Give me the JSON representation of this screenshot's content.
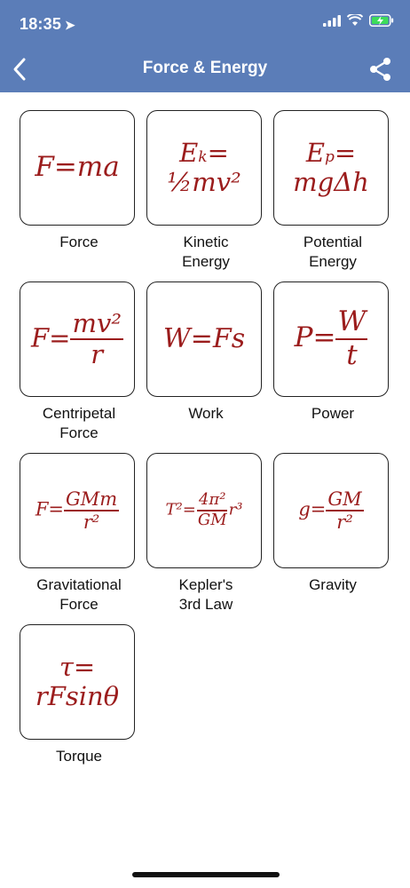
{
  "status_bar": {
    "time": "18:35",
    "battery": "charging"
  },
  "nav": {
    "title": "Force & Energy"
  },
  "formulas": [
    {
      "id": "force",
      "label_1": "Force",
      "label_2": "",
      "formula": "F=ma"
    },
    {
      "id": "kinetic",
      "label_1": "Kinetic",
      "label_2": "Energy",
      "line1_a": "E",
      "line1_sub": "k",
      "line1_b": "=",
      "line2": "½mv²"
    },
    {
      "id": "potential",
      "label_1": "Potential",
      "label_2": "Energy",
      "line1_a": "E",
      "line1_sub": "p",
      "line1_b": "=",
      "line2": "mgΔh"
    },
    {
      "id": "centripetal",
      "label_1": "Centripetal",
      "label_2": "Force",
      "lhs": "F=",
      "num": "mv²",
      "den": "r"
    },
    {
      "id": "work",
      "label_1": "Work",
      "label_2": "",
      "formula": "W=Fs"
    },
    {
      "id": "power",
      "label_1": "Power",
      "label_2": "",
      "lhs": "P=",
      "num": "W",
      "den": "t"
    },
    {
      "id": "gravitational",
      "label_1": "Gravitational",
      "label_2": "Force",
      "lhs": "F=",
      "num": "GMm",
      "den": "r²"
    },
    {
      "id": "kepler",
      "label_1": "Kepler's",
      "label_2": "3rd Law",
      "lhs": "T²=",
      "num": "4π²",
      "den": "GM",
      "rhs": "r³"
    },
    {
      "id": "gravity",
      "label_1": "Gravity",
      "label_2": "",
      "lhs": "g=",
      "num": "GM",
      "den": "r²"
    },
    {
      "id": "torque",
      "label_1": "Torque",
      "label_2": "",
      "line1": "τ=",
      "line2": "rFsinθ"
    }
  ],
  "colors": {
    "nav_bar": "#5b7db8",
    "formula": "#9b1c1c"
  }
}
